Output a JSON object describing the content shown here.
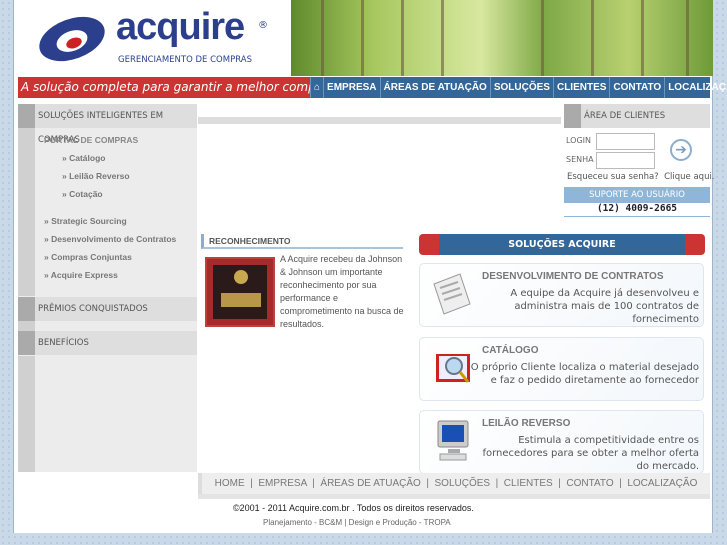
{
  "logo": {
    "brand": "acquire",
    "registered": "®",
    "tagline": "GERENCIAMENTO DE COMPRAS"
  },
  "header": {
    "slogan": "A solução completa para garantir a melhor compra.",
    "nav": [
      "EMPRESA",
      "ÁREAS DE ATUAÇÃO",
      "SOLUÇÕES",
      "CLIENTES",
      "CONTATO",
      "LOCALIZAÇÃO"
    ],
    "home_icon": "home-icon"
  },
  "sidebar": {
    "section1": "SOLUÇÕES INTELIGENTES EM COMPRAS",
    "portal": "PORTAL DE COMPRAS",
    "portal_items": [
      "» Catálogo",
      "» Leilão Reverso",
      "» Cotação"
    ],
    "items": [
      "» Strategic Sourcing",
      "» Desenvolvimento de Contratos",
      "» Compras Conjuntas",
      "» Acquire Express"
    ],
    "section2": "PRÊMIOS CONQUISTADOS",
    "section3": "BENEFÍCIOS"
  },
  "clients": {
    "title": "ÁREA DE CLIENTES",
    "login_label": "LOGIN",
    "password_label": "SENHA",
    "login_value": "",
    "password_value": "",
    "forgot": "Esqueceu sua senha?  Clique aqui.",
    "support": "SUPORTE AO USUÁRIO",
    "phone": "(12) 4009-2665"
  },
  "recognition": {
    "title": "RECONHECIMENTO",
    "text": "A Acquire recebeu da Johnson & Johnson um importante reconhecimento por sua performance e comprometimento na busca de resultados."
  },
  "solutions": {
    "title": "SOLUÇÕES ACQUIRE",
    "cards": [
      {
        "title": "DESENVOLVIMENTO DE CONTRATOS",
        "text": "A equipe da Acquire já desenvolveu e administra mais de 100 contratos de fornecimento",
        "icon": "document-icon"
      },
      {
        "title": "CATÁLOGO",
        "text": "O próprio Cliente localiza o material desejado e faz o pedido diretamente ao fornecedor",
        "icon": "catalog-magnifier-icon"
      },
      {
        "title": "LEILÃO REVERSO",
        "text": "Estimula a competitividade entre os fornecedores para se obter a melhor oferta do mercado.",
        "icon": "computer-icon"
      }
    ]
  },
  "footer": {
    "nav": "HOME  |  EMPRESA  |  ÁREAS DE ATUAÇÃO  |  SOLUÇÕES  |  CLIENTES  |  CONTATO  |  LOCALIZAÇÃO",
    "copyright": "©2001 - 2011 Acquire.com.br . Todos os direitos reservados.",
    "credits": "Planejamento - BC&M | Design e Produção - TROPA"
  },
  "colors": {
    "red": "#cc3333",
    "blue": "#336699",
    "navy": "#2b3f8c"
  }
}
